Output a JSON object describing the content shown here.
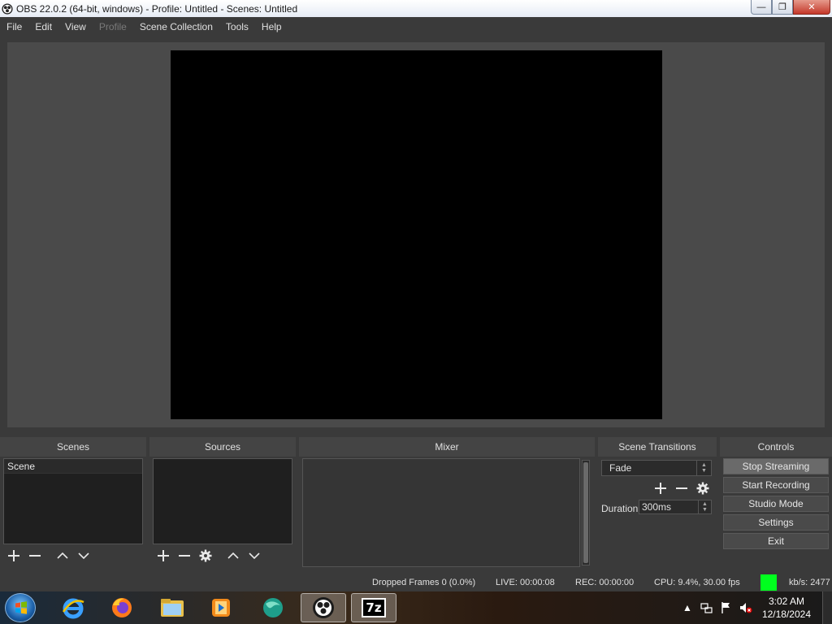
{
  "window": {
    "title": "OBS 22.0.2 (64-bit, windows) - Profile: Untitled - Scenes: Untitled",
    "minimize": "—",
    "maximize": "❐",
    "close": "✕"
  },
  "menu": {
    "items": [
      "File",
      "Edit",
      "View",
      "Profile",
      "Scene Collection",
      "Tools",
      "Help"
    ]
  },
  "docks": {
    "scenes": {
      "title": "Scenes",
      "items": [
        "Scene"
      ]
    },
    "sources": {
      "title": "Sources"
    },
    "mixer": {
      "title": "Mixer"
    },
    "transitions": {
      "title": "Scene Transitions",
      "selected": "Fade",
      "duration_label": "Duration",
      "duration_value": "300ms"
    },
    "controls": {
      "title": "Controls",
      "buttons": [
        "Stop Streaming",
        "Start Recording",
        "Studio Mode",
        "Settings",
        "Exit"
      ]
    }
  },
  "status": {
    "dropped_frames": "Dropped Frames 0 (0.0%)",
    "live": "LIVE: 00:00:08",
    "rec": "REC: 00:00:00",
    "cpu": "CPU: 9.4%, 30.00 fps",
    "kbs": "kb/s: 2477",
    "indicator_color": "#00ff1e"
  },
  "taskbar": {
    "apps": [
      "internet-explorer-icon",
      "firefox-icon",
      "file-explorer-icon",
      "media-player-icon",
      "browser-icon",
      "obs-icon",
      "7zip-icon"
    ],
    "app_7z_label": "7z",
    "clock_time": "3:02 AM",
    "clock_date": "12/18/2024"
  }
}
